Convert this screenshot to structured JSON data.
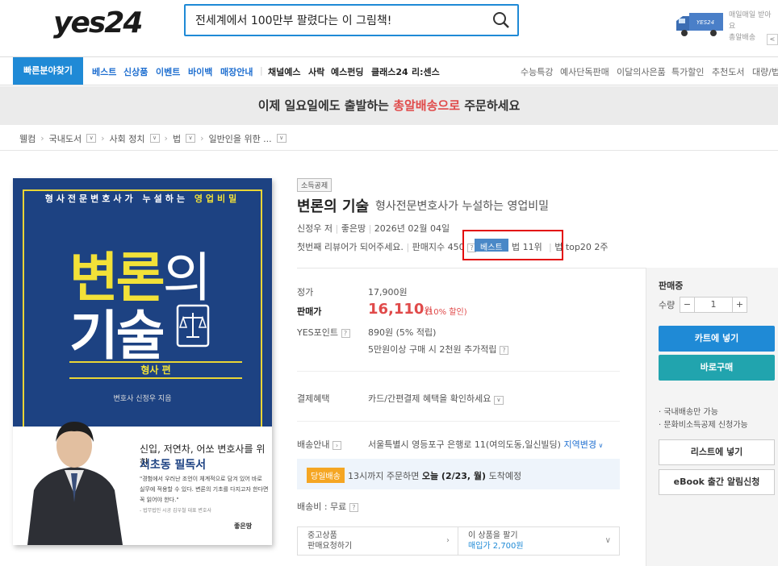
{
  "header": {
    "logo_text": "yes24",
    "search_value": "전세계에서 100만부 팔렸다는 이 그림책!",
    "truck_brand": "YES24",
    "delivery_promo": [
      "매일매일 받아요",
      "총알배송"
    ],
    "side_toggle": "<"
  },
  "nav": {
    "quick": "빠른분야찾기",
    "blue_items": [
      "베스트",
      "신상품",
      "이벤트",
      "바이백",
      "매장안내"
    ],
    "black_items": [
      "채널예스",
      "사락",
      "예스펀딩",
      "클래스24",
      "리:센스"
    ],
    "right_items": [
      "수능특강",
      "예사단독판매",
      "이달의사은품",
      "특가할인",
      "추천도서",
      "대량/법"
    ]
  },
  "banner": {
    "pre": "이제 일요일에도 출발하는",
    "highlight": "총알배송으로",
    "post": "주문하세요"
  },
  "breadcrumb": [
    "웰컴",
    "국내도서",
    "사회 정치",
    "법",
    "일반인을 위한 ..."
  ],
  "cover": {
    "subtitle": "형사전문변호사가 누설하는",
    "subtitle_hl": "영업비밀",
    "title_line1": "변론",
    "title_line1_light": "의",
    "title_line2": "기술",
    "edition": "형사 편",
    "author_line": "변호사 신정우 지음",
    "w1": "신입, 저연차, 어쏘 변호사를 위한",
    "w2": "서초동 필독서",
    "w3": "\"경험에서 우러난 조언이 체계적으로 담겨 있어 바로 실무에 적용할 수 있다. 변론의 기초를 다지고자 한다면 꼭 읽어야 한다.\"",
    "w4": "- 법무법인 시공 김우철 대표 변호사",
    "publisher": "좋은땅"
  },
  "product": {
    "tag": "소득공제",
    "title": "변론의 기술",
    "subtitle": "형사전문변호사가 누설하는 영업비밀",
    "author": "신정우 저",
    "publisher": "좋은땅",
    "date": "2026년 02월 04일",
    "review": "첫번째 리뷰어가 되어주세요.",
    "sales_index": "판매지수 450",
    "best_badge": "베스트",
    "rank1": "법 11위",
    "rank2": "법 top20 2주"
  },
  "price": {
    "list_label": "정가",
    "list_value": "17,900원",
    "sale_label": "판매가",
    "sale_value": "16,110",
    "sale_unit": "원",
    "discount": "(10% 할인)",
    "point_label": "YES포인트",
    "point_value": "890원 (5% 적립)",
    "point_extra": "5만원이상 구매 시 2천원 추가적립",
    "pay_label": "결제혜택",
    "pay_value": "카드/간편결제 혜택을 확인하세요",
    "ship_label": "배송안내",
    "ship_addr": "서울특별시 영등포구 은행로 11(여의도동,일신빌딩)",
    "ship_change": "지역변경",
    "today_tag": "당일배송",
    "today_pre": "13시까지 주문하면",
    "today_bold": "오늘 (2/23, 월)",
    "today_post": "도착예정",
    "ship_fee": "배송비 : 무료",
    "used_l1": "중고상품",
    "used_l2": "판매요청하기",
    "used_r1": "이 상품을 팔기",
    "used_r2": "매입가 2,700원"
  },
  "side": {
    "status": "판매중",
    "qty_label": "수량",
    "qty_minus": "−",
    "qty_value": "1",
    "qty_plus": "+",
    "cart": "카트에 넣기",
    "buy": "바로구매",
    "note1": "· 국내배송만 가능",
    "note2": "· 문화비소득공제 신청가능",
    "list": "리스트에 넣기",
    "ebook": "eBook 출간 알림신청"
  },
  "colors": {
    "accent": "#1f8ad6",
    "price": "#e04a4a",
    "cover_bg": "#1d4282",
    "cover_yellow": "#f2e138",
    "highlight_box": "#e30b0b"
  }
}
